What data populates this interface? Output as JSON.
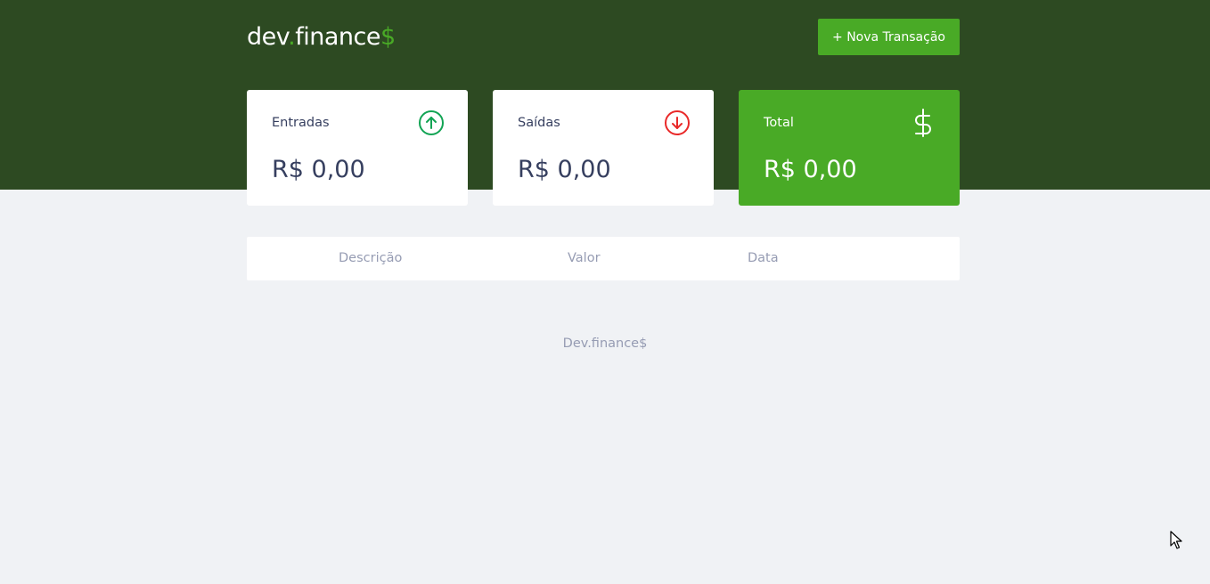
{
  "header": {
    "logo": {
      "part1": "dev",
      "dot": ".",
      "part2": "finance",
      "symbol": "$"
    },
    "new_transaction_label": "+ Nova Transação"
  },
  "cards": {
    "income": {
      "label": "Entradas",
      "value": "R$ 0,00",
      "icon": "arrow-up-circle-icon",
      "icon_color": "#12a454"
    },
    "expense": {
      "label": "Saídas",
      "value": "R$ 0,00",
      "icon": "arrow-down-circle-icon",
      "icon_color": "#e92929"
    },
    "total": {
      "label": "Total",
      "value": "R$ 0,00",
      "icon": "dollar-sign-icon",
      "icon_color": "#ffffff"
    }
  },
  "table": {
    "columns": [
      "Descrição",
      "Valor",
      "Data"
    ],
    "rows": []
  },
  "footer": {
    "text": "Dev.finance$"
  },
  "colors": {
    "header_bg": "#2d4a22",
    "accent": "#49aa26",
    "page_bg": "#f0f2f5",
    "text": "#363f5f",
    "muted": "#969cb3"
  }
}
